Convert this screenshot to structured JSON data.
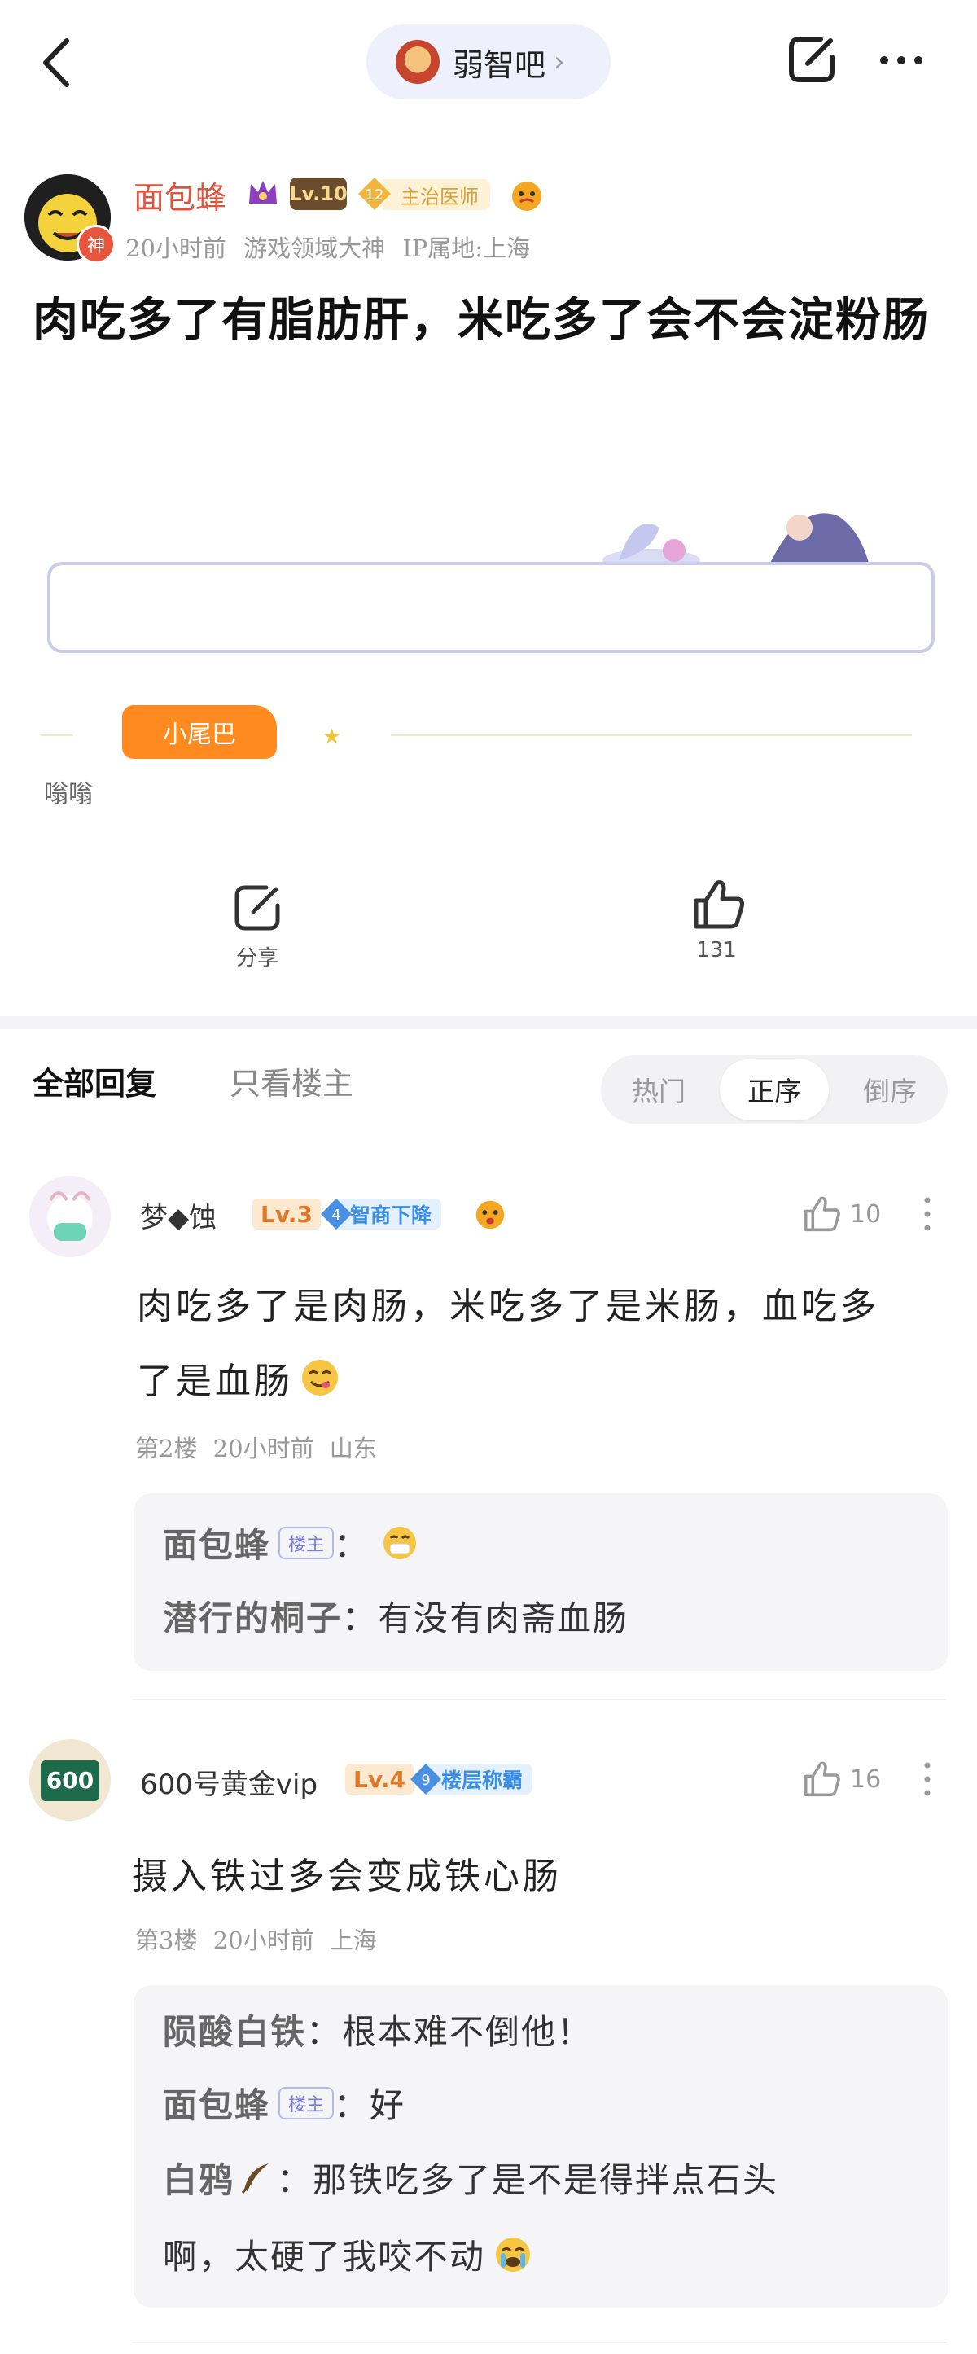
{
  "forum": {
    "name": "弱智吧",
    "chevron": "›"
  },
  "post": {
    "author": {
      "name": "面包蜂",
      "god_badge": "神",
      "level": "Lv.10",
      "rank_num": "12",
      "rank_title": "主治医师"
    },
    "meta": "20小时前  游戏领域大神  IP属地:上海",
    "title": "肉吃多了有脂肪肝，米吃多了会不会淀粉肠",
    "tail_badge": "小尾巴",
    "tail_text": "嗡嗡",
    "share_label": "分享",
    "like_count": "131"
  },
  "tabs": {
    "all": "全部回复",
    "op_only": "只看楼主"
  },
  "sort": {
    "hot": "热门",
    "asc": "正序",
    "desc": "倒序",
    "selected": "正序"
  },
  "replies": [
    {
      "name": "梦◆蚀",
      "level": "Lv.3",
      "rank_num": "4",
      "rank_title": "智商下降",
      "likes": "10",
      "body_line1": "肉吃多了是肉肠，米吃多了是米肠，血吃多",
      "body_line2": "了是血肠",
      "meta": "第2楼  20小时前  山东",
      "subs": [
        {
          "name": "面包蜂",
          "op_tag": "楼主",
          "sep": "：",
          "text": ""
        },
        {
          "name": "潜行的桐子",
          "sep": "：",
          "text": "有没有肉斋血肠"
        }
      ]
    },
    {
      "name": "600号黄金vip",
      "avatar_text": "600",
      "level": "Lv.4",
      "rank_num": "9",
      "rank_title": "楼层称霸",
      "likes": "16",
      "body_line1": "摄入铁过多会变成铁心肠",
      "meta": "第3楼  20小时前  上海",
      "subs": [
        {
          "name": "陨酸白铁",
          "sep": "：",
          "text": "根本难不倒他！"
        },
        {
          "name": "面包蜂",
          "op_tag": "楼主",
          "sep": "：",
          "text": "好"
        },
        {
          "name": "白鸦",
          "sep": "：",
          "text": "那铁吃多了是不是得拌点石头",
          "text2": "啊，太硬了我咬不动"
        }
      ]
    }
  ],
  "colors": {
    "accent_orange": "#ff8a1f",
    "author_red": "#e0533d",
    "badge_blue": "#3a8ee8"
  }
}
